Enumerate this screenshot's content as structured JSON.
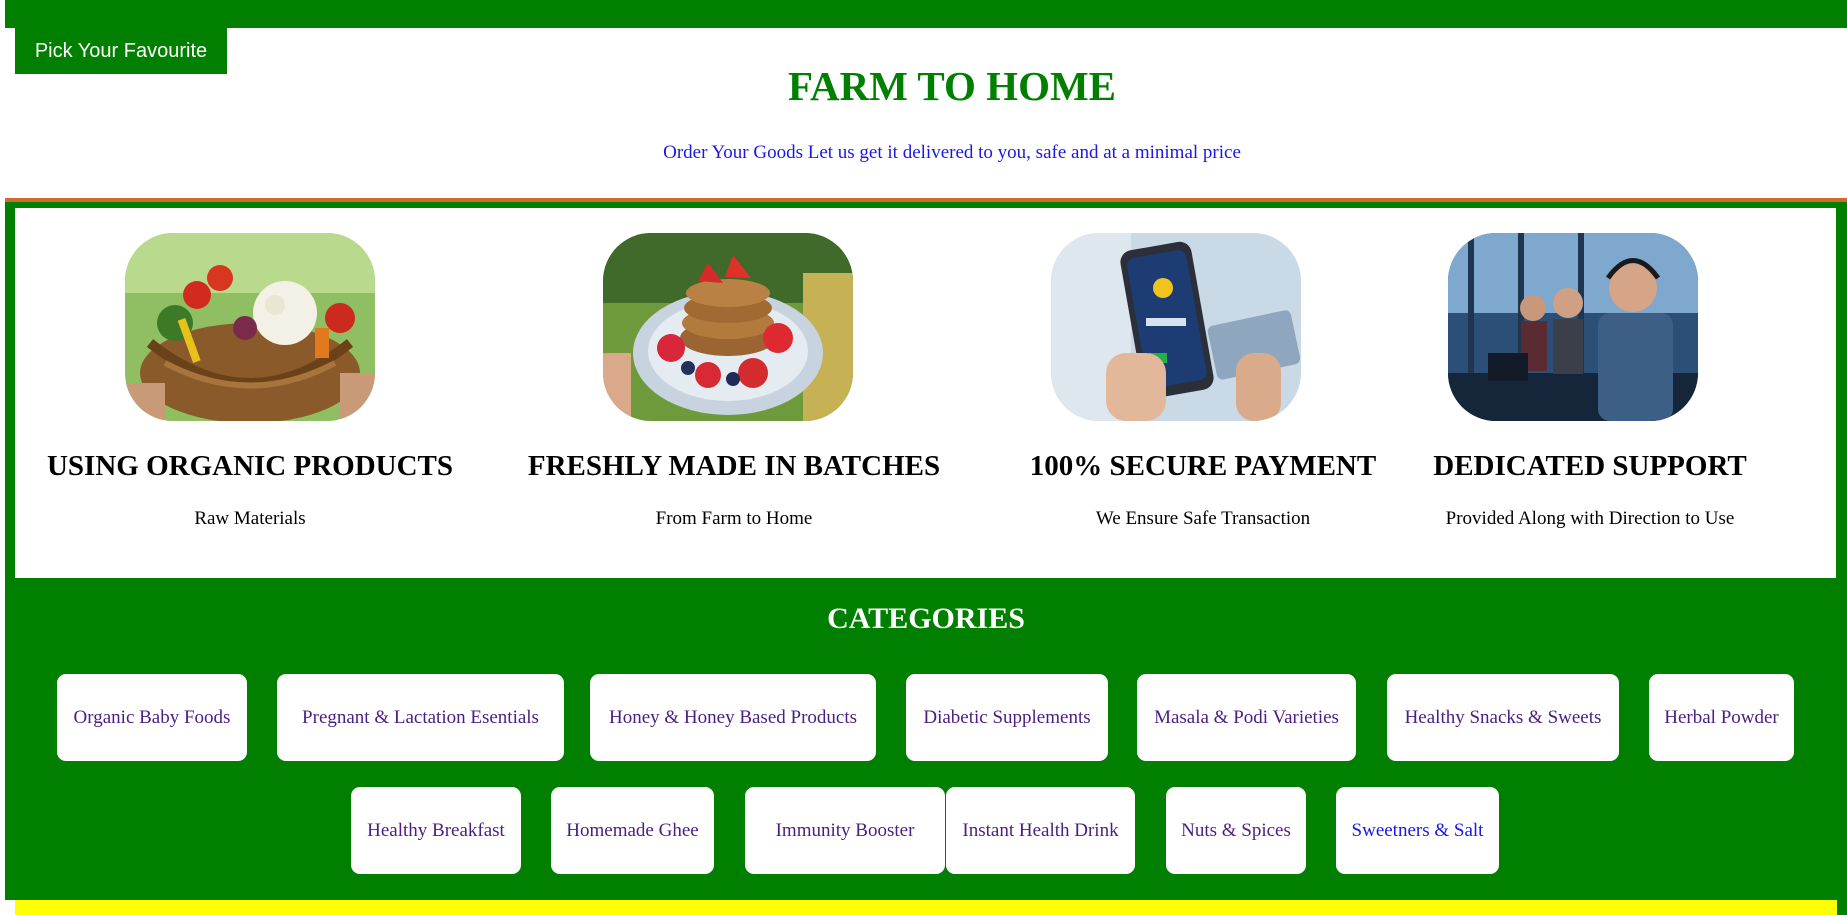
{
  "header": {
    "pick_tab": "Pick Your Favourite",
    "title": "FARM TO HOME",
    "subtitle": "Order Your Goods Let us get it delivered to you, safe and at a minimal price"
  },
  "features": [
    {
      "title": "USING ORGANIC PRODUCTS",
      "desc": "Raw Materials",
      "image": "vegetable-basket"
    },
    {
      "title": "FRESHLY MADE IN BATCHES",
      "desc": "From Farm to Home",
      "image": "pancakes-with-berries"
    },
    {
      "title": "100% SECURE PAYMENT",
      "desc": "We Ensure Safe Transaction",
      "image": "phone-otp-payment"
    },
    {
      "title": "DEDICATED SUPPORT",
      "desc": "Provided Along with Direction to Use",
      "image": "call-center-agents"
    }
  ],
  "categories": {
    "title": "CATEGORIES",
    "row1": [
      "Organic Baby Foods",
      "Pregnant & Lactation Esentials",
      "Honey & Honey Based Products",
      "Diabetic Supplements",
      "Masala & Podi Varieties",
      "Healthy Snacks & Sweets",
      "Herbal Powder"
    ],
    "row2": [
      "Healthy Breakfast",
      "Homemade Ghee",
      "Immunity Booster",
      "Instant Health Drink",
      "Nuts & Spices",
      "Sweetners & Salt"
    ]
  },
  "colors": {
    "brand_green": "#007f00",
    "link_blue": "#1a18e6",
    "visited_purple": "#4b1e82",
    "accent_orange": "#d4692e",
    "footer_yellow": "#ffff00"
  }
}
